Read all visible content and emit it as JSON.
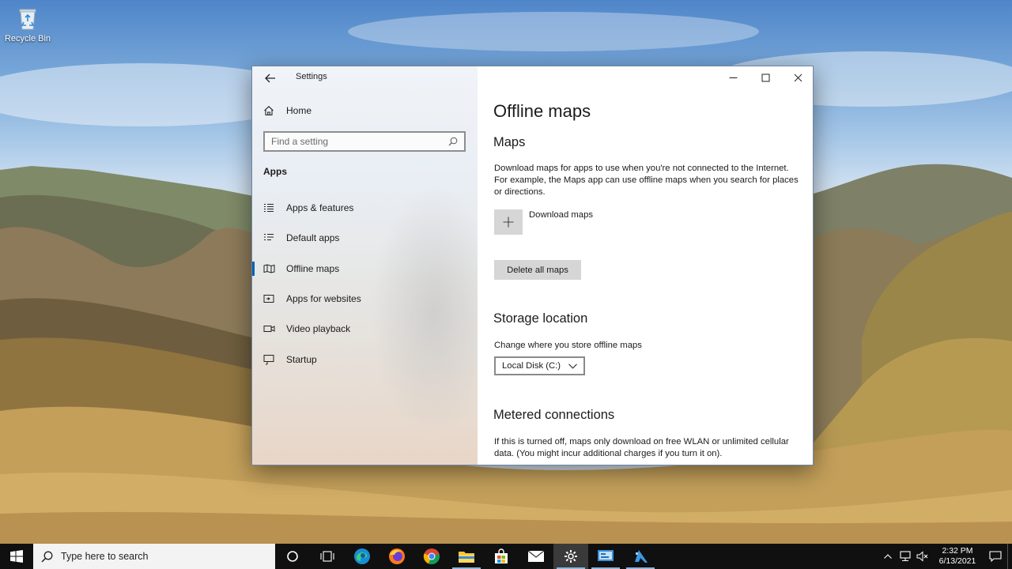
{
  "desktop": {
    "icons": [
      {
        "label": "Recycle Bin",
        "icon": "recycle-bin-icon"
      }
    ]
  },
  "window": {
    "title": "Settings",
    "sidebar": {
      "home_label": "Home",
      "search_placeholder": "Find a setting",
      "section_label": "Apps",
      "items": [
        {
          "label": "Apps & features",
          "icon": "apps-features-icon",
          "active": false
        },
        {
          "label": "Default apps",
          "icon": "default-apps-icon",
          "active": false
        },
        {
          "label": "Offline maps",
          "icon": "map-icon",
          "active": true
        },
        {
          "label": "Apps for websites",
          "icon": "apps-websites-icon",
          "active": false
        },
        {
          "label": "Video playback",
          "icon": "video-icon",
          "active": false
        },
        {
          "label": "Startup",
          "icon": "startup-icon",
          "active": false
        }
      ]
    },
    "content": {
      "page_title": "Offline maps",
      "maps_heading": "Maps",
      "maps_description": "Download maps for apps to use when you're not connected to the Internet. For example, the Maps app can use offline maps when you search for places or directions.",
      "download_label": "Download maps",
      "delete_label": "Delete all maps",
      "storage_heading": "Storage location",
      "storage_description": "Change where you store offline maps",
      "storage_selected": "Local Disk (C:)",
      "metered_heading": "Metered connections",
      "metered_description": "If this is turned off, maps only download on free WLAN or unlimited cellular data. (You might incur additional charges if you turn it on)."
    }
  },
  "taskbar": {
    "search_placeholder": "Type here to search",
    "apps": [
      {
        "name": "cortana-button",
        "icon": "cortana-icon",
        "running": false,
        "active": false
      },
      {
        "name": "task-view-button",
        "icon": "task-view-icon",
        "running": false,
        "active": false
      },
      {
        "name": "edge-button",
        "icon": "edge-icon",
        "running": false,
        "active": false
      },
      {
        "name": "firefox-button",
        "icon": "firefox-icon",
        "running": false,
        "active": false
      },
      {
        "name": "chrome-button",
        "icon": "chrome-icon",
        "running": false,
        "active": false
      },
      {
        "name": "file-explorer-button",
        "icon": "folder-icon",
        "running": true,
        "active": false
      },
      {
        "name": "store-button",
        "icon": "store-icon",
        "running": false,
        "active": false
      },
      {
        "name": "mail-button",
        "icon": "mail-icon",
        "running": false,
        "active": false
      },
      {
        "name": "settings-button",
        "icon": "gear-icon",
        "running": true,
        "active": true
      },
      {
        "name": "control-panel-button",
        "icon": "control-panel-icon",
        "running": true,
        "active": false
      },
      {
        "name": "azure-button",
        "icon": "azure-icon",
        "running": true,
        "active": false
      }
    ],
    "tray": {
      "time": "2:32 PM",
      "date": "6/13/2021"
    }
  }
}
